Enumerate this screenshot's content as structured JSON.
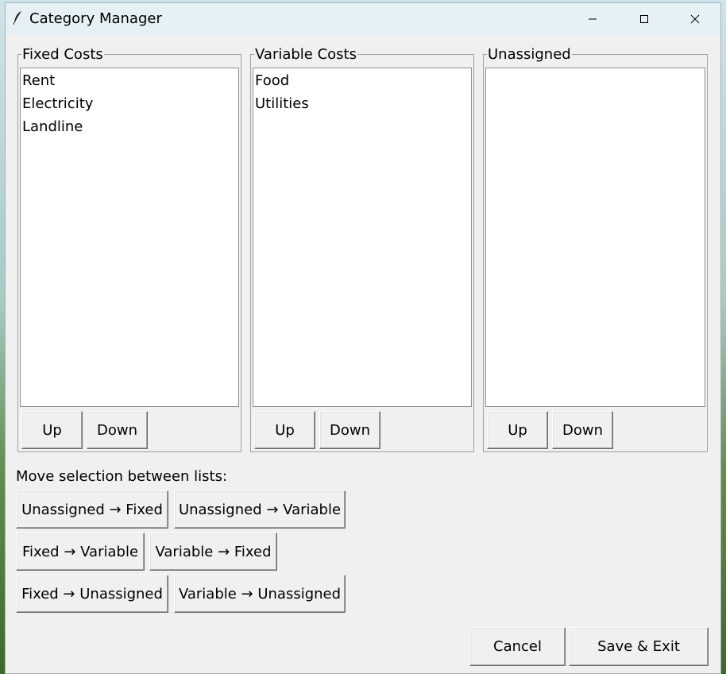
{
  "window": {
    "title": "Category Manager"
  },
  "lists": [
    {
      "label": "Fixed Costs",
      "items": [
        "Rent",
        "Electricity",
        "Landline"
      ],
      "up_label": "Up",
      "down_label": "Down"
    },
    {
      "label": "Variable Costs",
      "items": [
        "Food",
        "Utilities"
      ],
      "up_label": "Up",
      "down_label": "Down"
    },
    {
      "label": "Unassigned",
      "items": [],
      "up_label": "Up",
      "down_label": "Down"
    }
  ],
  "move": {
    "label": "Move selection between lists:",
    "unassigned_to_fixed": "Unassigned → Fixed",
    "unassigned_to_variable": "Unassigned → Variable",
    "fixed_to_variable": "Fixed → Variable",
    "variable_to_fixed": "Variable → Fixed",
    "fixed_to_unassigned": "Fixed → Unassigned",
    "variable_to_unassigned": "Variable → Unassigned"
  },
  "footer": {
    "cancel": "Cancel",
    "save_exit": "Save & Exit"
  },
  "icons": {
    "app": "feather-icon",
    "minimize": "minimize-icon",
    "maximize": "maximize-icon",
    "close": "close-icon"
  }
}
